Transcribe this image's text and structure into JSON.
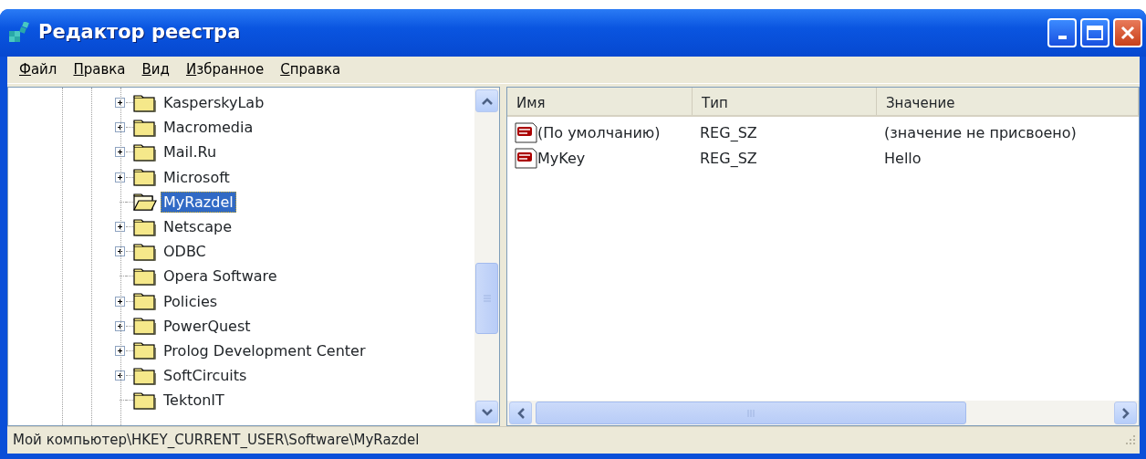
{
  "window": {
    "title": "Редактор реестра"
  },
  "menu": [
    "Файл",
    "Правка",
    "Вид",
    "Избранное",
    "Справка"
  ],
  "tree": {
    "items": [
      {
        "label": "KasperskyLab",
        "expandable": true,
        "selected": false
      },
      {
        "label": "Macromedia",
        "expandable": true,
        "selected": false
      },
      {
        "label": "Mail.Ru",
        "expandable": true,
        "selected": false
      },
      {
        "label": "Microsoft",
        "expandable": true,
        "selected": false
      },
      {
        "label": "MyRazdel",
        "expandable": false,
        "selected": true
      },
      {
        "label": "Netscape",
        "expandable": true,
        "selected": false
      },
      {
        "label": "ODBC",
        "expandable": true,
        "selected": false
      },
      {
        "label": "Opera Software",
        "expandable": false,
        "selected": false
      },
      {
        "label": "Policies",
        "expandable": true,
        "selected": false
      },
      {
        "label": "PowerQuest",
        "expandable": true,
        "selected": false
      },
      {
        "label": "Prolog Development Center",
        "expandable": true,
        "selected": false
      },
      {
        "label": "SoftCircuits",
        "expandable": true,
        "selected": false
      },
      {
        "label": "TektonIT",
        "expandable": false,
        "selected": false
      }
    ]
  },
  "values": {
    "columns": [
      "Имя",
      "Тип",
      "Значение"
    ],
    "rows": [
      {
        "name": "(По умолчанию)",
        "type": "REG_SZ",
        "data": "(значение не присвоено)"
      },
      {
        "name": "MyKey",
        "type": "REG_SZ",
        "data": "Hello"
      }
    ]
  },
  "status_bar": "Мой компьютер\\HKEY_CURRENT_USER\\Software\\MyRazdel"
}
